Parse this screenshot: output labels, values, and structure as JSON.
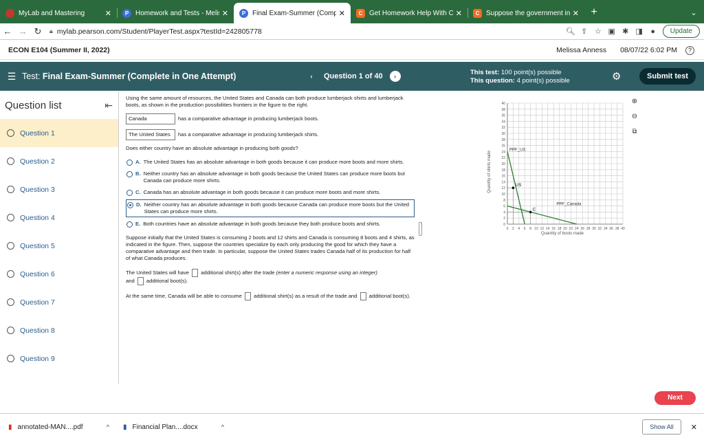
{
  "browser": {
    "tabs": [
      {
        "title": "MyLab and Mastering",
        "icon_color": "#c0392b",
        "icon": "",
        "active": false
      },
      {
        "title": "Homework and Tests - Melissa",
        "icon_color": "#3a6fd8",
        "icon": "P",
        "active": false
      },
      {
        "title": "Final Exam-Summer (Complete",
        "icon_color": "#3a6fd8",
        "icon": "P",
        "active": true
      },
      {
        "title": "Get Homework Help With Chegg",
        "icon_color": "#f26b21",
        "icon": "C",
        "active": false
      },
      {
        "title": "Suppose the government incre",
        "icon_color": "#f26b21",
        "icon": "C",
        "active": false
      }
    ],
    "new_tab": "+",
    "url": "mylab.pearson.com/Student/PlayerTest.aspx?testId=242805778",
    "update_label": "Update"
  },
  "course": {
    "name": "ECON E104 (Summer II, 2022)",
    "user": "Melissa Anness",
    "datetime": "08/07/22 6:02 PM"
  },
  "test": {
    "label": "Test:",
    "title": "Final Exam-Summer (Complete in One Attempt)",
    "question_label": "Question 1 of 40",
    "points_this_test_label": "This test:",
    "points_this_test": "100 point(s) possible",
    "points_this_question_label": "This question:",
    "points_this_question": "4 point(s) possible",
    "submit_label": "Submit test"
  },
  "sidebar": {
    "title": "Question list",
    "items": [
      {
        "label": "Question 1"
      },
      {
        "label": "Question 2"
      },
      {
        "label": "Question 3"
      },
      {
        "label": "Question 4"
      },
      {
        "label": "Question 5"
      },
      {
        "label": "Question 6"
      },
      {
        "label": "Question 7"
      },
      {
        "label": "Question 8"
      },
      {
        "label": "Question 9"
      }
    ]
  },
  "question": {
    "intro": "Using the same amount of resources, the United States and Canada can both produce lumberjack shirts and lumberjack boots, as shown in the production possibilities frontiers in the figure to the right.",
    "fill1_value": "Canada",
    "fill1_text": "has a comparative advantage in producing lumberjack boots.",
    "fill2_value": "The United States",
    "fill2_text": "has a comparative advantage in producing lumberjack shirts.",
    "prompt": "Does either country have an absolute advantage in producing both goods?",
    "options": [
      {
        "letter": "A.",
        "text": "The United States has an absolute advantage in both goods because it can produce more boots and more shirts.",
        "selected": false
      },
      {
        "letter": "B.",
        "text": "Neither country has an absolute advantage in both goods because the United States can produce more boots but Canada can produce more shirts.",
        "selected": false
      },
      {
        "letter": "C.",
        "text": "Canada has an absolute advantage in both goods because it can produce more boots and more shirts.",
        "selected": false
      },
      {
        "letter": "D.",
        "text": "Neither country has an absolute advantage in both goods because Canada can produce more boots but the United States can produce more shirts.",
        "selected": true
      },
      {
        "letter": "E.",
        "text": "Both countries have an absolute advantage in both goods because they both produce boots and shirts.",
        "selected": false
      }
    ],
    "scenario": "Suppose initially that the United States is consuming 2 boots and 12 shirts and Canada is consuming 8 boots and 4 shirts, as indicated in the figure. Then, suppose the countries specialize by each only producing the good for which they have a comparative advantage and then trade. In particular, suppose the United States trades Canada half of its production for half of what Canada produces.",
    "us_pre": "The United States will have",
    "us_mid": "additional shirt(s) after the trade",
    "us_hint": "(enter a numeric response using an integer)",
    "us_and": "and",
    "us_post": "additional boot(s).",
    "ca_pre": "At the same time, Canada will be able to consume",
    "ca_mid": "additional shirt(s) as a result of the trade and",
    "ca_post": "additional boot(s)."
  },
  "chart_data": {
    "type": "line",
    "xlabel": "Quantity of boots made",
    "ylabel": "Quantity of shirts made",
    "xlim": [
      0,
      40
    ],
    "ylim": [
      0,
      40
    ],
    "x_ticks": [
      0,
      2,
      4,
      6,
      8,
      10,
      12,
      14,
      16,
      18,
      20,
      22,
      24,
      26,
      28,
      30,
      32,
      34,
      36,
      38,
      40
    ],
    "y_ticks": [
      0,
      2,
      4,
      6,
      8,
      10,
      12,
      14,
      16,
      18,
      20,
      22,
      24,
      26,
      28,
      30,
      32,
      34,
      36,
      38,
      40
    ],
    "grid": true,
    "series": [
      {
        "name": "PPF_US",
        "color": "#2e7d32",
        "points": [
          [
            0,
            24
          ],
          [
            6,
            0
          ]
        ]
      },
      {
        "name": "PPF_Canada",
        "color": "#2e7d32",
        "points": [
          [
            0,
            6
          ],
          [
            24,
            0
          ]
        ]
      }
    ],
    "consumption_points": [
      {
        "label": "US",
        "x": 2,
        "y": 12
      },
      {
        "label": "C",
        "x": 8,
        "y": 4
      }
    ]
  },
  "footer": {
    "next_label": "Next"
  },
  "downloads": {
    "items": [
      {
        "name": "annotated-MAN....pdf"
      },
      {
        "name": "Financial Plan....docx"
      }
    ],
    "show_all": "Show All"
  }
}
